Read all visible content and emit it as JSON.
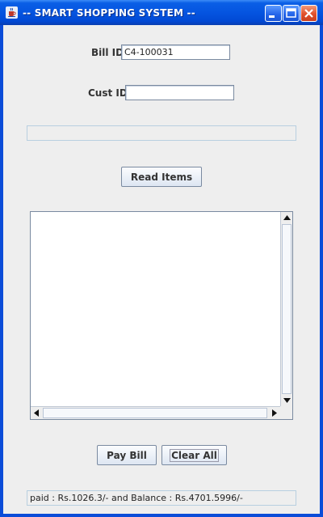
{
  "window": {
    "title": "-- SMART SHOPPING SYSTEM --",
    "icons": {
      "app": "java-cup-icon",
      "minimize": "minimize-icon",
      "maximize": "maximize-icon",
      "close": "close-icon"
    },
    "colors": {
      "titlebar": "#0554e0",
      "background": "#eeeeee",
      "close": "#e0502b"
    }
  },
  "form": {
    "bill_id": {
      "label": "Bill ID",
      "value": "C4-100031"
    },
    "cust_id": {
      "label": "Cust ID",
      "value": ""
    }
  },
  "buttons": {
    "read_items": "Read Items",
    "pay_bill": "Pay Bill",
    "clear_all": "Clear All"
  },
  "items_area": {
    "text": ""
  },
  "status": {
    "text": "paid : Rs.1026.3/- and Balance : Rs.4701.5996/-"
  }
}
